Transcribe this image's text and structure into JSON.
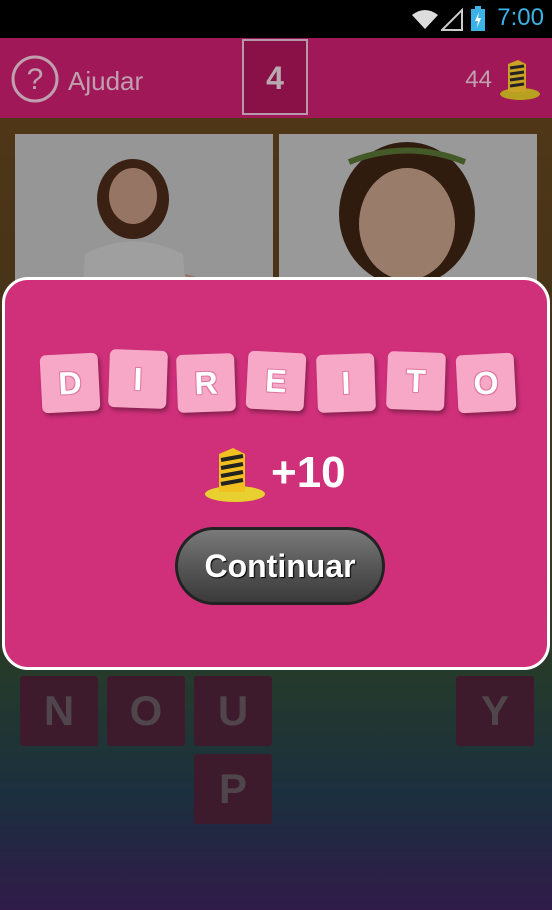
{
  "status_bar": {
    "time": "7:00"
  },
  "header": {
    "help_label": "Ajudar",
    "level": "4",
    "coins": "44"
  },
  "photos": [
    {
      "icon": "girl-photo-1"
    },
    {
      "icon": "girl-photo-2"
    }
  ],
  "letter_tiles": [
    {
      "letter": "N"
    },
    {
      "letter": "O"
    },
    {
      "letter": "U"
    },
    {
      "letter": "Y"
    },
    {
      "letter": "P"
    }
  ],
  "dialog": {
    "word_letters": [
      "D",
      "I",
      "R",
      "E",
      "I",
      "T",
      "O"
    ],
    "reward_amount": "+10",
    "continue_label": "Continuar"
  },
  "colors": {
    "header_bg": "#a01858",
    "dialog_bg": "#d0307a",
    "tile_pink": "#f6a8c6",
    "clock_blue": "#3bb3e6"
  }
}
